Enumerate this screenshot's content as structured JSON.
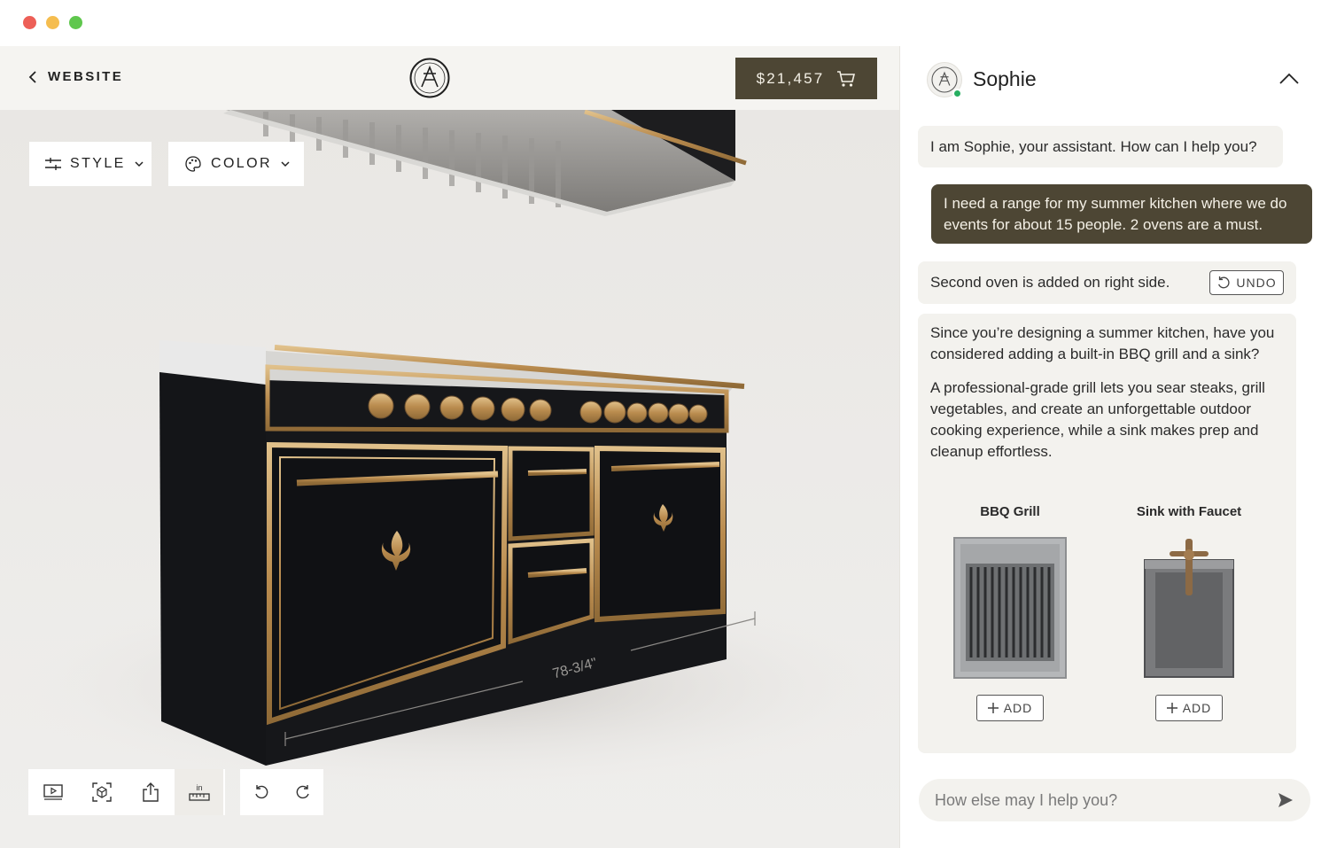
{
  "window": {
    "controls": [
      "close",
      "minimize",
      "zoom"
    ]
  },
  "header": {
    "back_label": "WEBSITE",
    "logo_icon": "brand-monogram-icon",
    "cart_total": "$21,457",
    "cart_icon": "cart-icon"
  },
  "toolbar": {
    "style_label": "STYLE",
    "color_label": "COLOR"
  },
  "viewer": {
    "dimension_label": "78-3/4\"",
    "tools": [
      "play-video-icon",
      "ar-view-icon",
      "share-icon",
      "measure-icon"
    ],
    "measure_label": "in",
    "history": [
      "undo-icon",
      "redo-icon"
    ]
  },
  "chat": {
    "agent_name": "Sophie",
    "status": "online",
    "messages": {
      "greeting": "I am Sophie, your assistant. How can I help you?",
      "user": "I need a range for my summer kitchen where we do events for about 15 people. 2 ovens are a must.",
      "system": "Second oven is added on right side.",
      "undo_label": "UNDO",
      "suggestion_p1": "Since you’re designing a summer kitchen, have you considered adding a built-in BBQ grill and a sink?",
      "suggestion_p2": "A professional-grade grill lets you sear steaks, grill vegetables, and create an unforgettable outdoor cooking experience, while a sink makes prep and cleanup effortless."
    },
    "suggestions": [
      {
        "title": "BBQ Grill",
        "add_label": "ADD"
      },
      {
        "title": "Sink with Faucet",
        "add_label": "ADD"
      }
    ],
    "input_placeholder": "How else may I help you?"
  },
  "colors": {
    "accent": "#4d4634",
    "range_body": "#15161a",
    "brass": "#c49a5c",
    "online": "#27ae60"
  }
}
